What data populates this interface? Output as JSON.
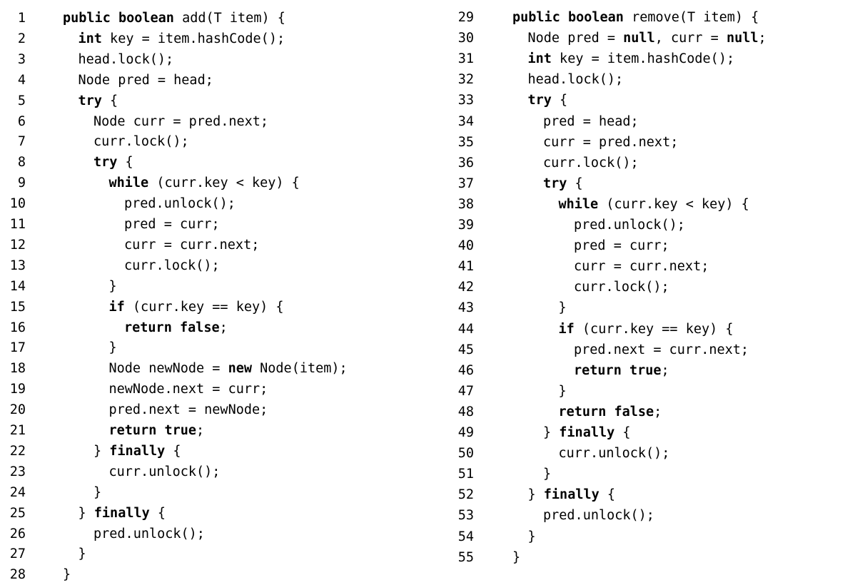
{
  "listings": [
    {
      "method": "add",
      "lines": [
        {
          "n": "1",
          "indent": 0,
          "tokens": [
            {
              "k": 1,
              "t": "public boolean"
            },
            {
              "k": 0,
              "t": " add(T item) {"
            }
          ]
        },
        {
          "n": "2",
          "indent": 1,
          "tokens": [
            {
              "k": 1,
              "t": "int"
            },
            {
              "k": 0,
              "t": " key = item.hashCode();"
            }
          ]
        },
        {
          "n": "3",
          "indent": 1,
          "tokens": [
            {
              "k": 0,
              "t": "head.lock();"
            }
          ]
        },
        {
          "n": "4",
          "indent": 1,
          "tokens": [
            {
              "k": 0,
              "t": "Node pred = head;"
            }
          ]
        },
        {
          "n": "5",
          "indent": 1,
          "tokens": [
            {
              "k": 1,
              "t": "try"
            },
            {
              "k": 0,
              "t": " {"
            }
          ]
        },
        {
          "n": "6",
          "indent": 2,
          "tokens": [
            {
              "k": 0,
              "t": "Node curr = pred.next;"
            }
          ]
        },
        {
          "n": "7",
          "indent": 2,
          "tokens": [
            {
              "k": 0,
              "t": "curr.lock();"
            }
          ]
        },
        {
          "n": "8",
          "indent": 2,
          "tokens": [
            {
              "k": 1,
              "t": "try"
            },
            {
              "k": 0,
              "t": " {"
            }
          ]
        },
        {
          "n": "9",
          "indent": 3,
          "tokens": [
            {
              "k": 1,
              "t": "while"
            },
            {
              "k": 0,
              "t": " (curr.key < key) {"
            }
          ]
        },
        {
          "n": "10",
          "indent": 4,
          "tokens": [
            {
              "k": 0,
              "t": "pred.unlock();"
            }
          ]
        },
        {
          "n": "11",
          "indent": 4,
          "tokens": [
            {
              "k": 0,
              "t": "pred = curr;"
            }
          ]
        },
        {
          "n": "12",
          "indent": 4,
          "tokens": [
            {
              "k": 0,
              "t": "curr = curr.next;"
            }
          ]
        },
        {
          "n": "13",
          "indent": 4,
          "tokens": [
            {
              "k": 0,
              "t": "curr.lock();"
            }
          ]
        },
        {
          "n": "14",
          "indent": 3,
          "tokens": [
            {
              "k": 0,
              "t": "}"
            }
          ]
        },
        {
          "n": "15",
          "indent": 3,
          "tokens": [
            {
              "k": 1,
              "t": "if"
            },
            {
              "k": 0,
              "t": " (curr.key == key) {"
            }
          ]
        },
        {
          "n": "16",
          "indent": 4,
          "tokens": [
            {
              "k": 1,
              "t": "return false"
            },
            {
              "k": 0,
              "t": ";"
            }
          ]
        },
        {
          "n": "17",
          "indent": 3,
          "tokens": [
            {
              "k": 0,
              "t": "}"
            }
          ]
        },
        {
          "n": "18",
          "indent": 3,
          "tokens": [
            {
              "k": 0,
              "t": "Node newNode = "
            },
            {
              "k": 1,
              "t": "new"
            },
            {
              "k": 0,
              "t": " Node(item);"
            }
          ]
        },
        {
          "n": "19",
          "indent": 3,
          "tokens": [
            {
              "k": 0,
              "t": "newNode.next = curr;"
            }
          ]
        },
        {
          "n": "20",
          "indent": 3,
          "tokens": [
            {
              "k": 0,
              "t": "pred.next = newNode;"
            }
          ]
        },
        {
          "n": "21",
          "indent": 3,
          "tokens": [
            {
              "k": 1,
              "t": "return true"
            },
            {
              "k": 0,
              "t": ";"
            }
          ]
        },
        {
          "n": "22",
          "indent": 2,
          "tokens": [
            {
              "k": 0,
              "t": "} "
            },
            {
              "k": 1,
              "t": "finally"
            },
            {
              "k": 0,
              "t": " {"
            }
          ]
        },
        {
          "n": "23",
          "indent": 3,
          "tokens": [
            {
              "k": 0,
              "t": "curr.unlock();"
            }
          ]
        },
        {
          "n": "24",
          "indent": 2,
          "tokens": [
            {
              "k": 0,
              "t": "}"
            }
          ]
        },
        {
          "n": "25",
          "indent": 1,
          "tokens": [
            {
              "k": 0,
              "t": "} "
            },
            {
              "k": 1,
              "t": "finally"
            },
            {
              "k": 0,
              "t": " {"
            }
          ]
        },
        {
          "n": "26",
          "indent": 2,
          "tokens": [
            {
              "k": 0,
              "t": "pred.unlock();"
            }
          ]
        },
        {
          "n": "27",
          "indent": 1,
          "tokens": [
            {
              "k": 0,
              "t": "}"
            }
          ]
        },
        {
          "n": "28",
          "indent": 0,
          "tokens": [
            {
              "k": 0,
              "t": "}"
            }
          ]
        }
      ]
    },
    {
      "method": "remove",
      "lines": [
        {
          "n": "29",
          "indent": 0,
          "tokens": [
            {
              "k": 1,
              "t": "public boolean"
            },
            {
              "k": 0,
              "t": " remove(T item) {"
            }
          ]
        },
        {
          "n": "30",
          "indent": 1,
          "tokens": [
            {
              "k": 0,
              "t": "Node pred = "
            },
            {
              "k": 1,
              "t": "null"
            },
            {
              "k": 0,
              "t": ", curr = "
            },
            {
              "k": 1,
              "t": "null"
            },
            {
              "k": 0,
              "t": ";"
            }
          ]
        },
        {
          "n": "31",
          "indent": 1,
          "tokens": [
            {
              "k": 1,
              "t": "int"
            },
            {
              "k": 0,
              "t": " key = item.hashCode();"
            }
          ]
        },
        {
          "n": "32",
          "indent": 1,
          "tokens": [
            {
              "k": 0,
              "t": "head.lock();"
            }
          ]
        },
        {
          "n": "33",
          "indent": 1,
          "tokens": [
            {
              "k": 1,
              "t": "try"
            },
            {
              "k": 0,
              "t": " {"
            }
          ]
        },
        {
          "n": "34",
          "indent": 2,
          "tokens": [
            {
              "k": 0,
              "t": "pred = head;"
            }
          ]
        },
        {
          "n": "35",
          "indent": 2,
          "tokens": [
            {
              "k": 0,
              "t": "curr = pred.next;"
            }
          ]
        },
        {
          "n": "36",
          "indent": 2,
          "tokens": [
            {
              "k": 0,
              "t": "curr.lock();"
            }
          ]
        },
        {
          "n": "37",
          "indent": 2,
          "tokens": [
            {
              "k": 1,
              "t": "try"
            },
            {
              "k": 0,
              "t": " {"
            }
          ]
        },
        {
          "n": "38",
          "indent": 3,
          "tokens": [
            {
              "k": 1,
              "t": "while"
            },
            {
              "k": 0,
              "t": " (curr.key < key) {"
            }
          ]
        },
        {
          "n": "39",
          "indent": 4,
          "tokens": [
            {
              "k": 0,
              "t": "pred.unlock();"
            }
          ]
        },
        {
          "n": "40",
          "indent": 4,
          "tokens": [
            {
              "k": 0,
              "t": "pred = curr;"
            }
          ]
        },
        {
          "n": "41",
          "indent": 4,
          "tokens": [
            {
              "k": 0,
              "t": "curr = curr.next;"
            }
          ]
        },
        {
          "n": "42",
          "indent": 4,
          "tokens": [
            {
              "k": 0,
              "t": "curr.lock();"
            }
          ]
        },
        {
          "n": "43",
          "indent": 3,
          "tokens": [
            {
              "k": 0,
              "t": "}"
            }
          ]
        },
        {
          "n": "44",
          "indent": 3,
          "tokens": [
            {
              "k": 1,
              "t": "if"
            },
            {
              "k": 0,
              "t": " (curr.key == key) {"
            }
          ]
        },
        {
          "n": "45",
          "indent": 4,
          "tokens": [
            {
              "k": 0,
              "t": "pred.next = curr.next;"
            }
          ]
        },
        {
          "n": "46",
          "indent": 4,
          "tokens": [
            {
              "k": 1,
              "t": "return true"
            },
            {
              "k": 0,
              "t": ";"
            }
          ]
        },
        {
          "n": "47",
          "indent": 3,
          "tokens": [
            {
              "k": 0,
              "t": "}"
            }
          ]
        },
        {
          "n": "48",
          "indent": 3,
          "tokens": [
            {
              "k": 1,
              "t": "return false"
            },
            {
              "k": 0,
              "t": ";"
            }
          ]
        },
        {
          "n": "49",
          "indent": 2,
          "tokens": [
            {
              "k": 0,
              "t": "} "
            },
            {
              "k": 1,
              "t": "finally"
            },
            {
              "k": 0,
              "t": " {"
            }
          ]
        },
        {
          "n": "50",
          "indent": 3,
          "tokens": [
            {
              "k": 0,
              "t": "curr.unlock();"
            }
          ]
        },
        {
          "n": "51",
          "indent": 2,
          "tokens": [
            {
              "k": 0,
              "t": "}"
            }
          ]
        },
        {
          "n": "52",
          "indent": 1,
          "tokens": [
            {
              "k": 0,
              "t": "} "
            },
            {
              "k": 1,
              "t": "finally"
            },
            {
              "k": 0,
              "t": " {"
            }
          ]
        },
        {
          "n": "53",
          "indent": 2,
          "tokens": [
            {
              "k": 0,
              "t": "pred.unlock();"
            }
          ]
        },
        {
          "n": "54",
          "indent": 1,
          "tokens": [
            {
              "k": 0,
              "t": "}"
            }
          ]
        },
        {
          "n": "55",
          "indent": 0,
          "tokens": [
            {
              "k": 0,
              "t": "}"
            }
          ]
        }
      ]
    }
  ]
}
